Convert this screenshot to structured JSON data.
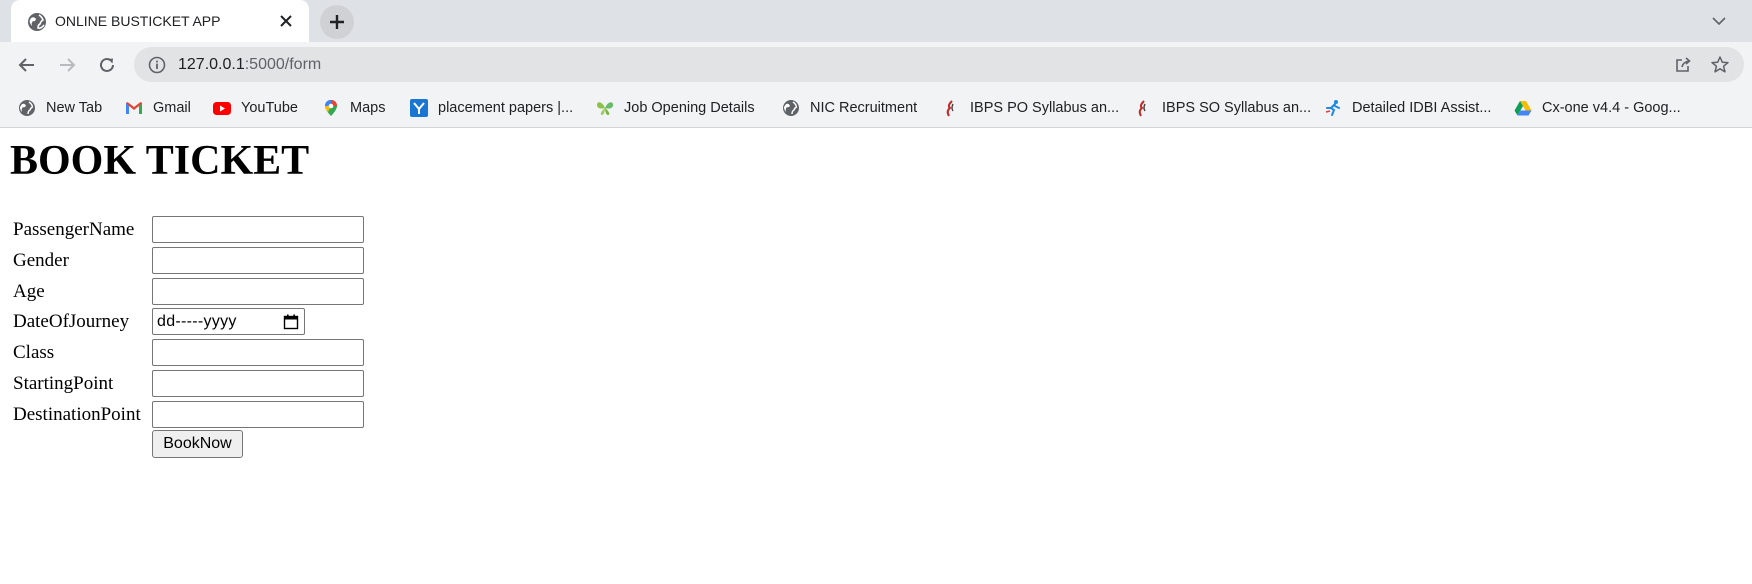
{
  "browser": {
    "tab": {
      "title": "ONLINE BUSTICKET APP",
      "favicon": "globe-icon"
    },
    "url": {
      "host": "127.0.0.1",
      "path": ":5000/form"
    },
    "bookmarks": [
      {
        "label": "New Tab",
        "icon": "chrome-icon"
      },
      {
        "label": "Gmail",
        "icon": "gmail-icon"
      },
      {
        "label": "YouTube",
        "icon": "youtube-icon"
      },
      {
        "label": "Maps",
        "icon": "maps-pin-icon"
      },
      {
        "label": "placement papers |...",
        "icon": "y-logo-icon"
      },
      {
        "label": "Job Opening Details",
        "icon": "butterfly-icon"
      },
      {
        "label": "NIC Recruitment",
        "icon": "globe-icon"
      },
      {
        "label": "IBPS PO Syllabus an...",
        "icon": "ibps-icon"
      },
      {
        "label": "IBPS SO Syllabus an...",
        "icon": "ibps-icon"
      },
      {
        "label": "Detailed IDBI Assist...",
        "icon": "runner-icon"
      },
      {
        "label": "Cx-one v4.4 - Goog...",
        "icon": "google-drive-icon"
      }
    ]
  },
  "page": {
    "heading": "BOOK TICKET",
    "fields": [
      {
        "label": "PassengerName",
        "value": ""
      },
      {
        "label": "Gender",
        "value": ""
      },
      {
        "label": "Age",
        "value": ""
      },
      {
        "label": "DateOfJourney",
        "placeholder": "dd-----yyyy"
      },
      {
        "label": "Class",
        "value": ""
      },
      {
        "label": "StartingPoint",
        "value": ""
      },
      {
        "label": "DestinationPoint",
        "value": ""
      }
    ],
    "submit_label": "BookNow"
  }
}
